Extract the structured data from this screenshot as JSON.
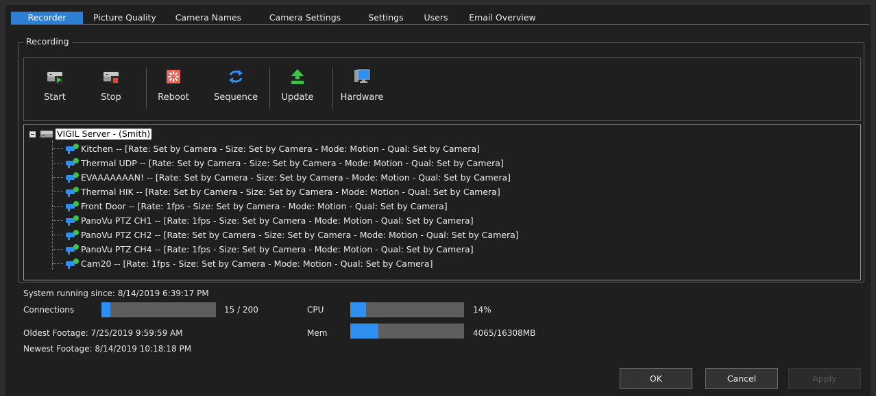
{
  "tabs": [
    {
      "label": "Recorder",
      "active": true
    },
    {
      "label": "Picture Quality",
      "active": false
    },
    {
      "label": "Camera Names",
      "active": false
    },
    {
      "label": "Camera Settings",
      "active": false
    },
    {
      "label": "Settings",
      "active": false
    },
    {
      "label": "Users",
      "active": false
    },
    {
      "label": "Email Overview",
      "active": false
    }
  ],
  "group_title": "Recording",
  "toolbar": {
    "start": "Start",
    "stop": "Stop",
    "reboot": "Reboot",
    "sequence": "Sequence",
    "update": "Update",
    "hardware": "Hardware"
  },
  "tree": {
    "root": "VIGIL Server - (Smith)",
    "cameras": [
      "Kitchen -- [Rate: Set by Camera - Size: Set by Camera - Mode: Motion - Qual: Set by Camera]",
      "Thermal UDP -- [Rate: Set by Camera - Size: Set by Camera - Mode: Motion - Qual: Set by Camera]",
      "EVAAAAAAAN! -- [Rate: Set by Camera - Size: Set by Camera - Mode: Motion - Qual: Set by Camera]",
      "Thermal HIK -- [Rate: Set by Camera - Size: Set by Camera - Mode: Motion - Qual: Set by Camera]",
      "Front Door -- [Rate: 1fps - Size: Set by Camera - Mode: Motion - Qual: Set by Camera]",
      "PanoVu PTZ CH1 -- [Rate: 1fps - Size: Set by Camera - Mode: Motion - Qual: Set by Camera]",
      "PanoVu PTZ CH2 -- [Rate: Set by Camera - Size: Set by Camera - Mode: Motion - Qual: Set by Camera]",
      "PanoVu PTZ CH4 -- [Rate: 1fps - Size: Set by Camera - Mode: Motion - Qual: Set by Camera]",
      "Cam20 -- [Rate: 1fps - Size: Set by Camera - Mode: Motion - Qual: Set by Camera]"
    ]
  },
  "status": {
    "running_since": "System running since: 8/14/2019 6:39:17 PM",
    "connections_label": "Connections",
    "connections_value": "15 / 200",
    "connections_fraction": 0.075,
    "cpu_label": "CPU",
    "cpu_value": "14%",
    "cpu_fraction": 0.14,
    "mem_label": "Mem",
    "mem_value": "4065/16308MB",
    "mem_fraction": 0.249,
    "oldest": "Oldest Footage: 7/25/2019 9:59:59 AM",
    "newest": "Newest Footage: 8/14/2019 10:18:18 PM"
  },
  "buttons": {
    "ok": "OK",
    "cancel": "Cancel",
    "apply": "Apply",
    "apply_enabled": false
  },
  "colors": {
    "accent": "#2e7ed3",
    "bar_fill": "#2e8ff0",
    "bar_track": "#5e5e5e",
    "background": "#1f1f1f"
  }
}
